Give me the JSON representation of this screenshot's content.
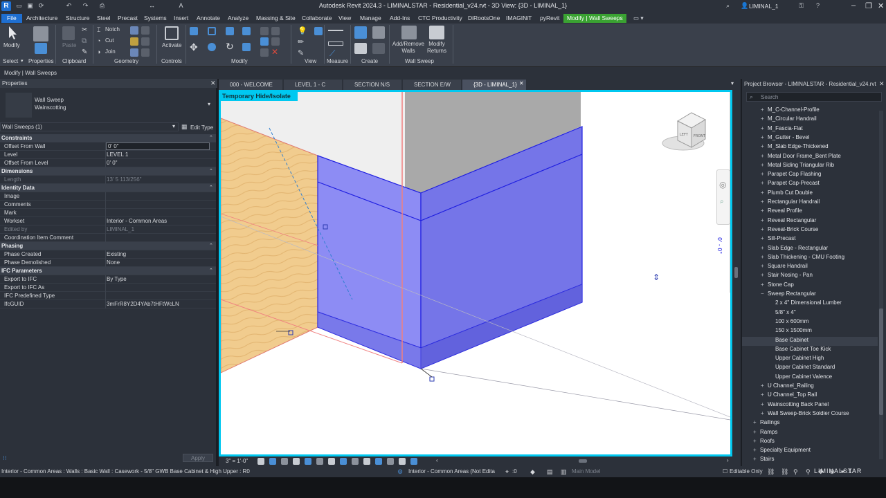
{
  "app": {
    "title": "Autodesk Revit 2024.3 - LIMINALSTAR - Residential_v24.rvt - 3D View: {3D - LIMINAL_1}",
    "logo": "R",
    "user": "LIMINAL_1"
  },
  "ribbon_tabs": [
    "File",
    "Architecture",
    "Structure",
    "Steel",
    "Precast",
    "Systems",
    "Insert",
    "Annotate",
    "Analyze",
    "Massing & Site",
    "Collaborate",
    "View",
    "Manage",
    "Add-Ins",
    "CTC Productivity",
    "DiRootsOne",
    "IMAGINiT",
    "pyRevit",
    "Modify | Wall Sweeps"
  ],
  "ribbon": {
    "modify_label": "Modify",
    "select_label": "Select",
    "properties_label": "Properties",
    "paste_label": "Paste",
    "clipboard_label": "Clipboard",
    "notch_label": "Notch",
    "cut_label": "Cut",
    "join_label": "Join",
    "geometry_label": "Geometry",
    "activate_label": "Activate",
    "controls_label": "Controls",
    "modify_group_label": "Modify",
    "view_label": "View",
    "measure_label": "Measure",
    "create_label": "Create",
    "add_remove_walls_label": "Add/Remove Walls",
    "modify_returns_label": "Modify Returns",
    "wall_sweep_label": "Wall Sweep"
  },
  "options_bar": "Modify | Wall Sweeps",
  "properties": {
    "title": "Properties",
    "type_family": "Wall Sweep",
    "type_name": "Wainscotting",
    "selector": "Wall Sweeps (1)",
    "edit_type": "Edit Type",
    "rows": [
      {
        "k": "Constraints",
        "group": true
      },
      {
        "k": "Offset From Wall",
        "v": "0'  0\""
      },
      {
        "k": "Level",
        "v": "LEVEL 1"
      },
      {
        "k": "Offset From Level",
        "v": "0'  0\""
      },
      {
        "k": "Dimensions",
        "group": true
      },
      {
        "k": "Length",
        "v": "13'  5 113/256\"",
        "dis": true
      },
      {
        "k": "Identity Data",
        "group": true
      },
      {
        "k": "Image",
        "v": ""
      },
      {
        "k": "Comments",
        "v": ""
      },
      {
        "k": "Mark",
        "v": ""
      },
      {
        "k": "Workset",
        "v": "Interior - Common Areas"
      },
      {
        "k": "Edited by",
        "v": "LIMINAL_1",
        "dis": true
      },
      {
        "k": "Coordination Item Comment",
        "v": ""
      },
      {
        "k": "Phasing",
        "group": true
      },
      {
        "k": "Phase Created",
        "v": "Existing"
      },
      {
        "k": "Phase Demolished",
        "v": "None"
      },
      {
        "k": "IFC Parameters",
        "group": true
      },
      {
        "k": "Export to IFC",
        "v": "By Type"
      },
      {
        "k": "Export to IFC As",
        "v": ""
      },
      {
        "k": "IFC Predefined Type",
        "v": ""
      },
      {
        "k": "IfcGUID",
        "v": "3mFrR8Y2D4YAb7tHFtWcLN"
      }
    ],
    "apply": "Apply"
  },
  "view_tabs": [
    "000 - WELCOME",
    "LEVEL 1 - C",
    "SECTION N/S",
    "SECTION E/W",
    "{3D - LIMINAL_1}"
  ],
  "temporary_label": "Temporary Hide/Isolate",
  "view_scale": "3\" = 1'-0\"",
  "dim_text": "0' - 0\"",
  "viewcube": {
    "left": "LEFT",
    "front": "FRONT"
  },
  "project_browser": {
    "title": "Project Browser - LIMINALSTAR - Residential_v24.rvt",
    "search_placeholder": "Search",
    "items": [
      {
        "t": "M_C-Channel-Profile",
        "lvl": 1,
        "s": "+"
      },
      {
        "t": "M_Circular Handrail",
        "lvl": 1,
        "s": "+"
      },
      {
        "t": "M_Fascia-Flat",
        "lvl": 1,
        "s": "+"
      },
      {
        "t": "M_Gutter - Bevel",
        "lvl": 1,
        "s": "+"
      },
      {
        "t": "M_Slab Edge-Thickened",
        "lvl": 1,
        "s": "+"
      },
      {
        "t": "Metal Door Frame_Bent Plate",
        "lvl": 1,
        "s": "+"
      },
      {
        "t": "Metal Siding Triangular Rib",
        "lvl": 1,
        "s": "+"
      },
      {
        "t": "Parapet Cap Flashing",
        "lvl": 1,
        "s": "+"
      },
      {
        "t": "Parapet Cap-Precast",
        "lvl": 1,
        "s": "+"
      },
      {
        "t": "Plumb Cut Double",
        "lvl": 1,
        "s": "+"
      },
      {
        "t": "Rectangular Handrail",
        "lvl": 1,
        "s": "+"
      },
      {
        "t": "Reveal Profile",
        "lvl": 1,
        "s": "+"
      },
      {
        "t": "Reveal Rectangular",
        "lvl": 1,
        "s": "+"
      },
      {
        "t": "Reveal-Brick Course",
        "lvl": 1,
        "s": "+"
      },
      {
        "t": "Sill-Precast",
        "lvl": 1,
        "s": "+"
      },
      {
        "t": "Slab Edge - Rectangular",
        "lvl": 1,
        "s": "+"
      },
      {
        "t": "Slab Thickening - CMU Footing",
        "lvl": 1,
        "s": "+"
      },
      {
        "t": "Square Handrail",
        "lvl": 1,
        "s": "+"
      },
      {
        "t": "Stair Nosing - Pan",
        "lvl": 1,
        "s": "+"
      },
      {
        "t": "Stone Cap",
        "lvl": 1,
        "s": "+"
      },
      {
        "t": "Sweep Rectangular",
        "lvl": 1,
        "s": "−"
      },
      {
        "t": "2 x 4\" Dimensional Lumber",
        "lvl": 2,
        "s": ""
      },
      {
        "t": "5/8\" x 4\"",
        "lvl": 2,
        "s": ""
      },
      {
        "t": "100 x 600mm",
        "lvl": 2,
        "s": ""
      },
      {
        "t": "150 x 1500mm",
        "lvl": 2,
        "s": ""
      },
      {
        "t": "Base Cabinet",
        "lvl": 2,
        "s": "",
        "sel": true
      },
      {
        "t": "Base Cabinet Toe Kick",
        "lvl": 2,
        "s": ""
      },
      {
        "t": "Upper Cabinet High",
        "lvl": 2,
        "s": ""
      },
      {
        "t": "Upper Cabinet Standard",
        "lvl": 2,
        "s": ""
      },
      {
        "t": "Upper Cabinet Valence",
        "lvl": 2,
        "s": ""
      },
      {
        "t": "U Channel_Railing",
        "lvl": 1,
        "s": "+"
      },
      {
        "t": "U Channel_Top Rail",
        "lvl": 1,
        "s": "+"
      },
      {
        "t": "Wainscotting Back Panel",
        "lvl": 1,
        "s": "+"
      },
      {
        "t": "Wall Sweep-Brick Soldier Course",
        "lvl": 1,
        "s": "+"
      },
      {
        "t": "Railings",
        "lvl": 0,
        "s": "+"
      },
      {
        "t": "Ramps",
        "lvl": 0,
        "s": "+"
      },
      {
        "t": "Roofs",
        "lvl": 0,
        "s": "+"
      },
      {
        "t": "Specialty Equipment",
        "lvl": 0,
        "s": "+"
      },
      {
        "t": "Stairs",
        "lvl": 0,
        "s": "+"
      }
    ]
  },
  "status": {
    "left": "Interior - Common Areas : Walls : Basic Wall : Casework - 5/8\" GWB Base Cabinet & High Upper : R0",
    "workset": "Interior - Common Areas (Not Edita",
    "count": ":0",
    "model": "Main Model",
    "editable": "Editable Only",
    "filter_count": ":1",
    "brand": "LIMINALSTAR"
  },
  "colors": {
    "accent": "#00c8f0",
    "sweep": "#7f7ff2",
    "file_tab": "#1f6fd1",
    "context_tab": "#3aa232"
  }
}
